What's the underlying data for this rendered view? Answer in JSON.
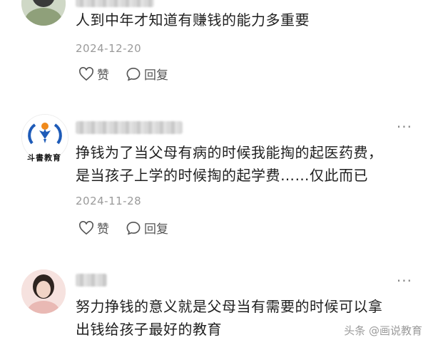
{
  "comments": [
    {
      "text": "人到中年才知道有赚钱的能力多重要",
      "date": "2024-12-20",
      "like_label": "赞",
      "reply_label": "回复"
    },
    {
      "avatar_text": "斗書教育",
      "text_line1": "挣钱为了当父母有病的时候我能掏的起医药费，",
      "text_line2": "是当孩子上学的时候掏的起学费……仅此而已",
      "date": "2024-11-28",
      "like_label": "赞",
      "reply_label": "回复",
      "more_label": "···"
    },
    {
      "text_line1": "努力挣钱的意义就是父母当有需要的时候可以拿",
      "text_line2": "出钱给孩子最好的教育",
      "more_label": "···"
    }
  ],
  "watermark": "头条 @画说教育",
  "colors": {
    "text": "#1f1f1f",
    "date": "#9a9a9a",
    "icon": "#555555"
  }
}
